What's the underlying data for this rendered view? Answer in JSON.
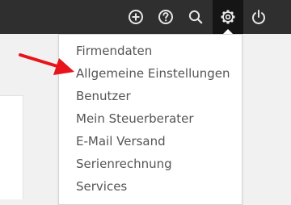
{
  "colors": {
    "topbar": "#2f2f2f",
    "topbar_active": "#151515",
    "icon": "#e6e6e6",
    "menu_text": "#555555",
    "annotation_arrow": "#e8131b"
  },
  "toolbar": {
    "icons": [
      "add-circle-icon",
      "help-circle-icon",
      "search-icon",
      "gear-icon",
      "power-icon"
    ],
    "active_icon": "gear-icon"
  },
  "settings_menu": {
    "items": [
      "Firmendaten",
      "Allgemeine Einstellungen",
      "Benutzer",
      "Mein Steuerberater",
      "E-Mail Versand",
      "Serienrechnung",
      "Services"
    ]
  },
  "annotation": {
    "type": "arrow",
    "target": "Allgemeine Einstellungen"
  }
}
